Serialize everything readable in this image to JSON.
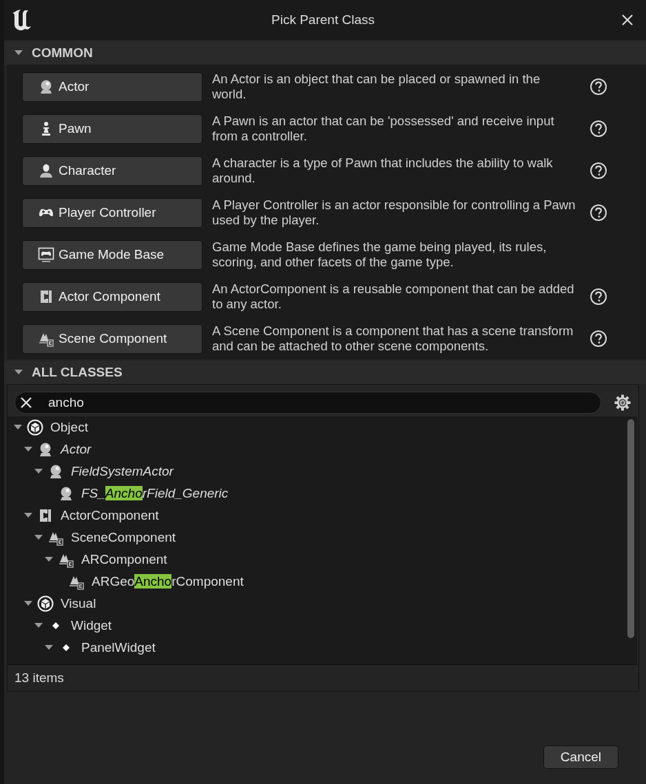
{
  "window": {
    "title": "Pick Parent Class"
  },
  "common": {
    "title": "COMMON",
    "expanded": true,
    "items": [
      {
        "kind": "sphere",
        "label": "Actor",
        "description": "An Actor is an object that can be placed or spawned in the world.",
        "help": true
      },
      {
        "kind": "pawn",
        "label": "Pawn",
        "description": "A Pawn is an actor that can be 'possessed' and receive input from a controller.",
        "help": true
      },
      {
        "kind": "character",
        "label": "Character",
        "description": "A character is a type of Pawn that includes the ability to walk around.",
        "help": true
      },
      {
        "kind": "gamepad",
        "label": "Player Controller",
        "description": "A Player Controller is an actor responsible for controlling a Pawn used by the player.",
        "help": true
      },
      {
        "kind": "gamemode",
        "label": "Game Mode Base",
        "description": "Game Mode Base defines the game being played, its rules, scoring, and other facets of the game type.",
        "help": false
      },
      {
        "kind": "component",
        "label": "Actor Component",
        "description": "An ActorComponent is a reusable component that can be added to any actor.",
        "help": true
      },
      {
        "kind": "scene",
        "label": "Scene Component",
        "description": "A Scene Component is a component that has a scene transform and can be attached to other scene components.",
        "help": true
      }
    ]
  },
  "all_classes": {
    "title": "ALL CLASSES",
    "expanded": true,
    "search": {
      "value": "ancho"
    },
    "tree": [
      {
        "kind": "object",
        "label": "Object",
        "italic": false,
        "expanded": true,
        "children": [
          {
            "kind": "sphere",
            "label": "Actor",
            "italic": true,
            "expanded": true,
            "children": [
              {
                "kind": "sphere",
                "label": "FieldSystemActor",
                "italic": true,
                "expanded": true,
                "children": [
                  {
                    "kind": "sphere",
                    "italic": true,
                    "expanded": false,
                    "label_parts": [
                      {
                        "text": "FS_",
                        "matched": false
                      },
                      {
                        "text": "Ancho",
                        "matched": true
                      },
                      {
                        "text": "rField_Generic",
                        "matched": false
                      }
                    ]
                  }
                ]
              }
            ]
          },
          {
            "kind": "component",
            "label": "ActorComponent",
            "italic": false,
            "expanded": true,
            "children": [
              {
                "kind": "scene",
                "label": "SceneComponent",
                "italic": false,
                "expanded": true,
                "children": [
                  {
                    "kind": "scene",
                    "label": "ARComponent",
                    "italic": false,
                    "expanded": true,
                    "children": [
                      {
                        "kind": "scene",
                        "italic": false,
                        "expanded": false,
                        "label_parts": [
                          {
                            "text": "ARGeo",
                            "matched": false
                          },
                          {
                            "text": "Ancho",
                            "matched": true
                          },
                          {
                            "text": "rComponent",
                            "matched": false
                          }
                        ]
                      }
                    ]
                  }
                ]
              }
            ]
          },
          {
            "kind": "object",
            "label": "Visual",
            "italic": false,
            "expanded": true,
            "children": [
              {
                "kind": "dot",
                "label": "Widget",
                "italic": false,
                "expanded": true,
                "children": [
                  {
                    "kind": "dot",
                    "label": "PanelWidget",
                    "italic": false,
                    "expanded": true
                  }
                ]
              }
            ]
          }
        ]
      }
    ],
    "status": "13 items"
  },
  "buttons": [
    {
      "label": "Cancel"
    }
  ]
}
